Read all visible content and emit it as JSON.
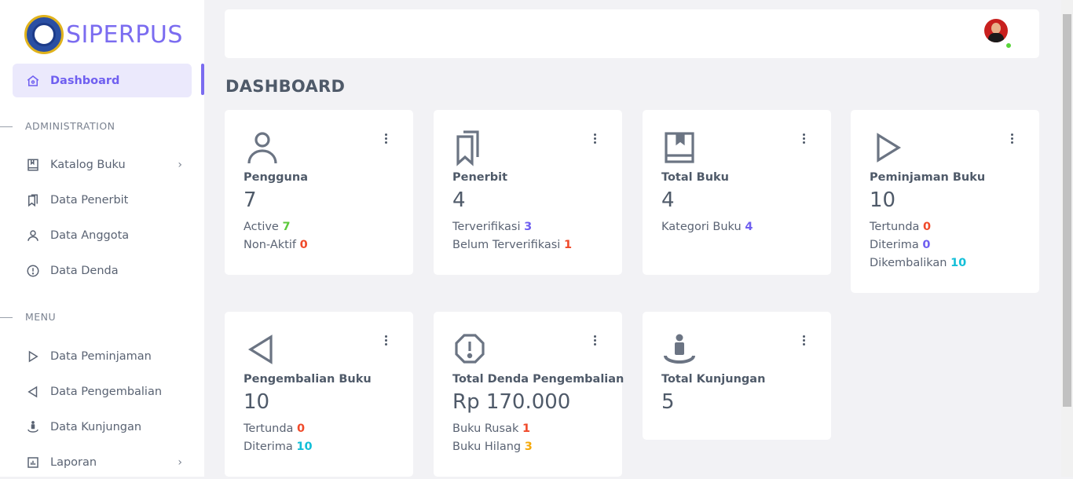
{
  "brand": {
    "name": "SIPERPUS"
  },
  "sidebar": {
    "active": {
      "label": "Dashboard",
      "icon": "home-icon"
    },
    "sections": [
      {
        "title": "ADMINISTRATION"
      },
      {
        "title": "MENU"
      }
    ],
    "admin_items": [
      {
        "label": "Katalog Buku",
        "icon": "book-icon",
        "has_submenu": true
      },
      {
        "label": "Data Penerbit",
        "icon": "bookmarks-icon",
        "has_submenu": false
      },
      {
        "label": "Data Anggota",
        "icon": "user-icon",
        "has_submenu": false
      },
      {
        "label": "Data Denda",
        "icon": "alert-circle-icon",
        "has_submenu": false
      }
    ],
    "menu_items": [
      {
        "label": "Data Peminjaman",
        "icon": "play-icon",
        "has_submenu": false
      },
      {
        "label": "Data Pengembalian",
        "icon": "back-icon",
        "has_submenu": false
      },
      {
        "label": "Data Kunjungan",
        "icon": "visitor-icon",
        "has_submenu": false
      },
      {
        "label": "Laporan",
        "icon": "chart-icon",
        "has_submenu": true
      }
    ]
  },
  "header": {
    "user_status": "online"
  },
  "page": {
    "title": "DASHBOARD"
  },
  "cards": [
    {
      "title": "Pengguna",
      "value": "7",
      "icon": "user-icon",
      "lines": [
        {
          "label": "Active",
          "value": "7",
          "color": "#5cc93b"
        },
        {
          "label": "Non-Aktif",
          "value": "0",
          "color": "#f04a2a"
        }
      ]
    },
    {
      "title": "Penerbit",
      "value": "4",
      "icon": "bookmarks-icon",
      "lines": [
        {
          "label": "Terverifikasi",
          "value": "3",
          "color": "#6f5ff0"
        },
        {
          "label": "Belum Terverifikasi",
          "value": "1",
          "color": "#f04a2a"
        }
      ]
    },
    {
      "title": "Total Buku",
      "value": "4",
      "icon": "book-icon",
      "lines": [
        {
          "label": "Kategori Buku",
          "value": "4",
          "color": "#6f5ff0"
        }
      ]
    },
    {
      "title": "Peminjaman Buku",
      "value": "10",
      "icon": "play-icon",
      "lines": [
        {
          "label": "Tertunda",
          "value": "0",
          "color": "#f04a2a"
        },
        {
          "label": "Diterima",
          "value": "0",
          "color": "#6f5ff0"
        },
        {
          "label": "Dikembalikan",
          "value": "10",
          "color": "#13bfd8"
        }
      ]
    },
    {
      "title": "Pengembalian Buku",
      "value": "10",
      "icon": "back-icon",
      "lines": [
        {
          "label": "Tertunda",
          "value": "0",
          "color": "#f04a2a"
        },
        {
          "label": "Diterima",
          "value": "10",
          "color": "#13bfd8"
        }
      ]
    },
    {
      "title": "Total Denda Pengembalian",
      "value": "Rp 170.000",
      "icon": "alert-octagon-icon",
      "lines": [
        {
          "label": "Buku Rusak",
          "value": "1",
          "color": "#f04a2a"
        },
        {
          "label": "Buku Hilang",
          "value": "3",
          "color": "#f5a90a"
        }
      ]
    },
    {
      "title": "Total Kunjungan",
      "value": "5",
      "icon": "visitor-icon",
      "lines": []
    }
  ]
}
